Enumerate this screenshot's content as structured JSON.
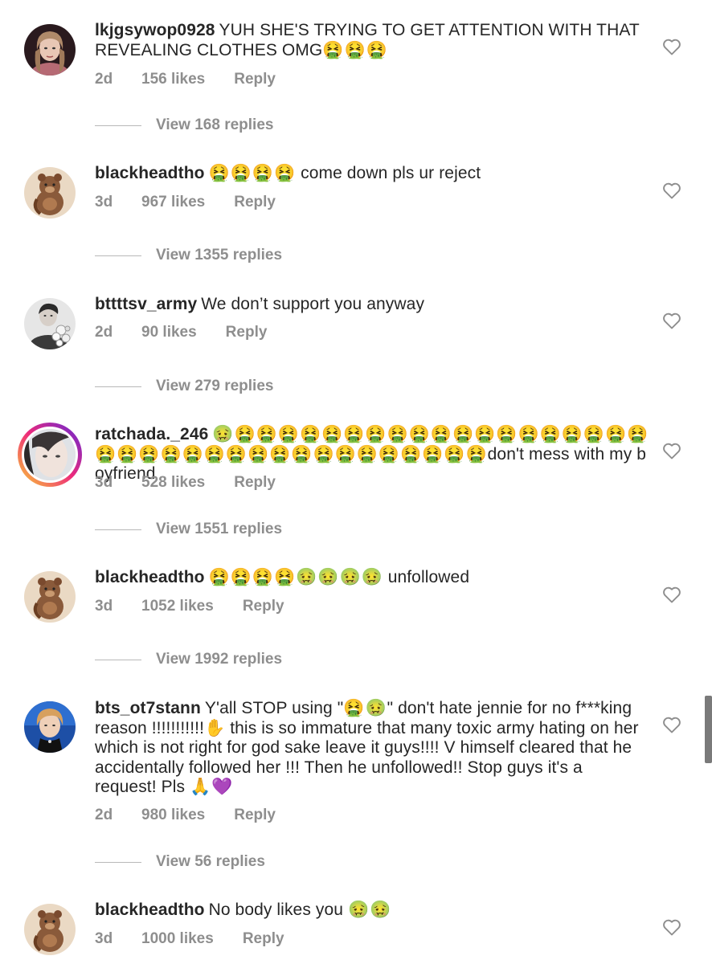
{
  "comments": [
    {
      "username": "lkjgsywop0928",
      "text": "YUH SHE'S TRYING TO GET ATTENTION WITH THAT REVEALING CLOTHES OMG",
      "emojis": "🤮🤮🤮",
      "time": "2d",
      "likes": "156 likes",
      "reply_label": "Reply",
      "view_replies": "View 168 replies",
      "avatar_icon": "portrait-avatar-icon"
    },
    {
      "username": "blackheadtho",
      "emojis": "🤮🤮🤮🤮",
      "text": "come down pls ur reject",
      "time": "3d",
      "likes": "967 likes",
      "reply_label": "Reply",
      "view_replies": "View 1355 replies",
      "avatar_icon": "bear-avatar-icon"
    },
    {
      "username": "bttttsv_army",
      "text": "We don’t support you anyway",
      "time": "2d",
      "likes": "90 likes",
      "reply_label": "Reply",
      "view_replies": "View 279 replies",
      "avatar_icon": "flowers-avatar-icon"
    },
    {
      "username": "ratchada._246",
      "emojis": "🤢🤮🤮🤮🤮🤮🤮🤮🤮🤮🤮🤮🤮🤮🤮🤮🤮🤮🤮🤮🤮🤮🤮🤮🤮🤮🤮🤮🤮🤮🤮🤮🤮🤮🤮🤮🤮🤮",
      "text": "don't mess with my boyfriend",
      "time": "3d",
      "likes": "528 likes",
      "reply_label": "Reply",
      "view_replies": "View 1551 replies",
      "avatar_icon": "face-avatar-icon"
    },
    {
      "username": "blackheadtho",
      "emojis": "🤮🤮🤮🤮🤢🤢🤢🤢",
      "text": "unfollowed",
      "time": "3d",
      "likes": "1052 likes",
      "reply_label": "Reply",
      "view_replies": "View 1992 replies",
      "avatar_icon": "bear-avatar-icon"
    },
    {
      "username": "bts_ot7stann",
      "text_before": "Y'all  STOP using \"",
      "inline_emojis": "🤮🤢",
      "text_mid": "\" don't hate jennie for no f***king reason !!!!!!!!!!!",
      "hand_emoji": "✋",
      "text_after": " this is so immature that many toxic army hating on her which is not right for god sake leave it guys!!!! V himself cleared that he accidentally followed her !!! Then he unfollowed!! Stop guys it's a request! Pls ",
      "end_emojis": "🙏💜",
      "time": "2d",
      "likes": "980 likes",
      "reply_label": "Reply",
      "view_replies": "View 56 replies",
      "avatar_icon": "portrait-avatar-icon"
    },
    {
      "username": "blackheadtho",
      "text": "No body likes you",
      "emojis": "🤢🤢",
      "time": "3d",
      "likes": "1000 likes",
      "reply_label": "Reply",
      "avatar_icon": "bear-avatar-icon"
    }
  ],
  "icons": {
    "like": "heart-outline-icon"
  },
  "colors": {
    "text": "#262626",
    "meta": "#8e8e8e",
    "story_ring": [
      "#f9ce34",
      "#ee2a7b",
      "#6228d7"
    ]
  }
}
